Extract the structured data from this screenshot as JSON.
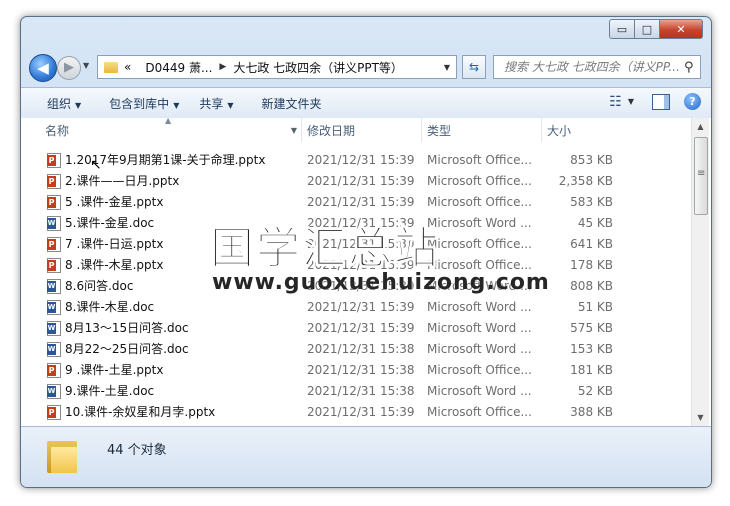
{
  "window": {
    "controls": {
      "minimize": "▭",
      "maximize": "□",
      "close": "✕"
    },
    "icons": {
      "back": "arrow-left",
      "forward": "arrow-right",
      "refresh": "refresh",
      "search": "magnifier",
      "help": "question-mark"
    }
  },
  "navbar": {
    "back_glyph": "◀",
    "forward_glyph": "▶",
    "address": {
      "chevron": "«",
      "crumbs": [
        "D0449 萧...",
        "大七政 七政四余（讲义PPT等）"
      ]
    },
    "search_placeholder": "搜索 大七政 七政四余（讲义PP..."
  },
  "toolbar": {
    "organize": "组织",
    "include_library": "包含到库中",
    "share": "共享",
    "new_folder": "新建文件夹"
  },
  "columns": {
    "name": "名称",
    "date": "修改日期",
    "type": "类型",
    "size": "大小"
  },
  "files": [
    {
      "name": "1.2017年9月期第1课-关于命理.pptx",
      "date": "2021/12/31 15:39",
      "type": "Microsoft Office...",
      "size": "853 KB",
      "kind": "ppt"
    },
    {
      "name": "2.课件——日月.pptx",
      "date": "2021/12/31 15:39",
      "type": "Microsoft Office...",
      "size": "2,358 KB",
      "kind": "ppt"
    },
    {
      "name": "5 .课件-金星.pptx",
      "date": "2021/12/31 15:39",
      "type": "Microsoft Office...",
      "size": "583 KB",
      "kind": "ppt"
    },
    {
      "name": "5.课件-金星.doc",
      "date": "2021/12/31 15:39",
      "type": "Microsoft Word ...",
      "size": "45 KB",
      "kind": "doc"
    },
    {
      "name": "7 .课件-日运.pptx",
      "date": "2021/12/31 15:39",
      "type": "Microsoft Office...",
      "size": "641 KB",
      "kind": "ppt"
    },
    {
      "name": "8 .课件-木星.pptx",
      "date": "2021/12/31 15:39",
      "type": "Microsoft Office...",
      "size": "178 KB",
      "kind": "ppt"
    },
    {
      "name": "8.6问答.doc",
      "date": "2021/12/31 15:39",
      "type": "Microsoft Word ...",
      "size": "808 KB",
      "kind": "doc"
    },
    {
      "name": "8.课件-木星.doc",
      "date": "2021/12/31 15:39",
      "type": "Microsoft Word ...",
      "size": "51 KB",
      "kind": "doc"
    },
    {
      "name": "8月13～15日问答.doc",
      "date": "2021/12/31 15:39",
      "type": "Microsoft Word ...",
      "size": "575 KB",
      "kind": "doc"
    },
    {
      "name": "8月22～25日问答.doc",
      "date": "2021/12/31 15:38",
      "type": "Microsoft Word ...",
      "size": "153 KB",
      "kind": "doc"
    },
    {
      "name": "9 .课件-土星.pptx",
      "date": "2021/12/31 15:38",
      "type": "Microsoft Office...",
      "size": "181 KB",
      "kind": "ppt"
    },
    {
      "name": "9.课件-土星.doc",
      "date": "2021/12/31 15:38",
      "type": "Microsoft Word ...",
      "size": "52 KB",
      "kind": "doc"
    },
    {
      "name": "10.课件-余奴星和月孛.pptx",
      "date": "2021/12/31 15:39",
      "type": "Microsoft Office...",
      "size": "388 KB",
      "kind": "ppt"
    }
  ],
  "status": {
    "count": "44 个对象"
  },
  "watermark": {
    "title": "国学汇总站",
    "url": "www.guoxuehuizong.com"
  }
}
